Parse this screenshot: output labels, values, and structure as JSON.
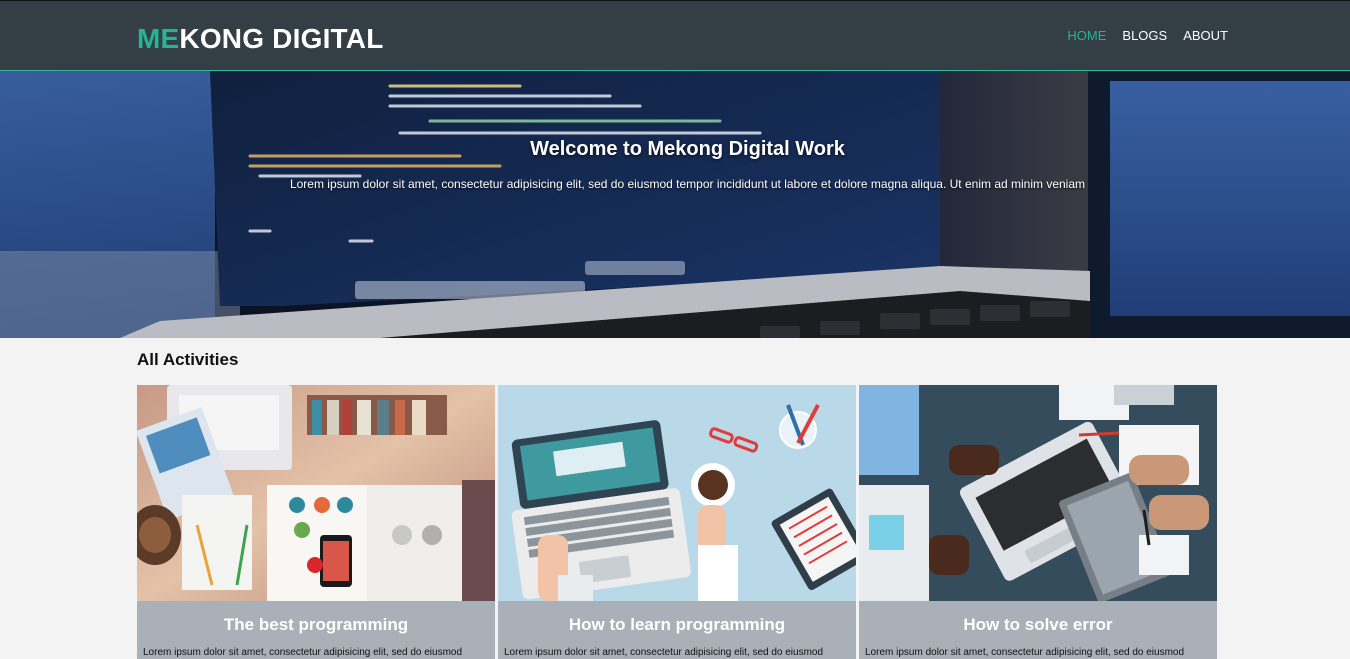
{
  "header": {
    "logo_accent": "ME",
    "logo_rest": "KONG DIGITAL",
    "nav": [
      {
        "label": "HOME",
        "active": true
      },
      {
        "label": "BLOGS",
        "active": false
      },
      {
        "label": "ABOUT",
        "active": false
      }
    ]
  },
  "hero": {
    "title": "Welcome to Mekong Digital Work",
    "subtitle": "Lorem ipsum dolor sit amet, consectetur adipisicing elit, sed do eiusmod tempor incididunt ut labore et dolore magna aliqua. Ut enim ad minim veniam"
  },
  "section": {
    "title": "All Activities"
  },
  "cards": [
    {
      "title": "The best programming",
      "text": "Lorem ipsum dolor sit amet, consectetur adipisicing elit, sed do eiusmod"
    },
    {
      "title": "How to learn programming",
      "text": "Lorem ipsum dolor sit amet, consectetur adipisicing elit, sed do eiusmod"
    },
    {
      "title": "How to solve error",
      "text": "Lorem ipsum dolor sit amet, consectetur adipisicing elit, sed do eiusmod"
    }
  ],
  "colors": {
    "header_bg": "#333e45",
    "accent": "#25b594",
    "card_footer": "#aab0b7",
    "page_bg": "#f3f3f3"
  }
}
